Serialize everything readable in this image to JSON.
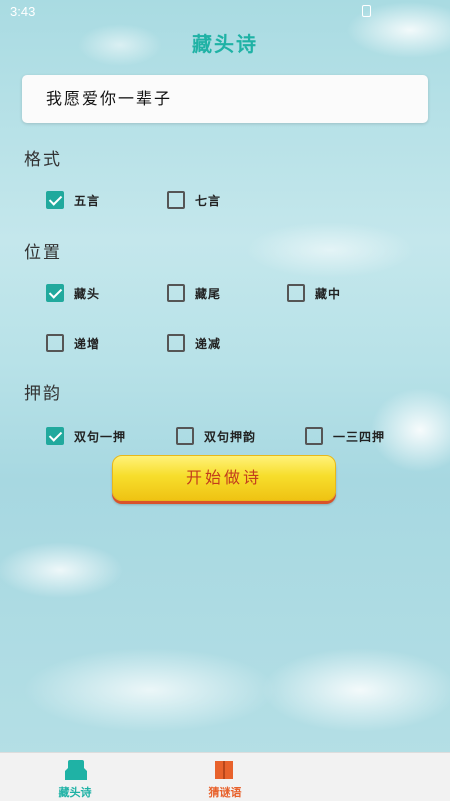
{
  "status_bar": {
    "time": "3:43"
  },
  "header": {
    "title": "藏头诗"
  },
  "input": {
    "value": "我愿爱你一辈子"
  },
  "format": {
    "label": "格式",
    "options": [
      {
        "label": "五言",
        "checked": true
      },
      {
        "label": "七言",
        "checked": false
      }
    ]
  },
  "position": {
    "label": "位置",
    "options": [
      {
        "label": "藏头",
        "checked": true
      },
      {
        "label": "藏尾",
        "checked": false
      },
      {
        "label": "藏中",
        "checked": false
      },
      {
        "label": "递增",
        "checked": false
      },
      {
        "label": "递减",
        "checked": false
      }
    ]
  },
  "rhyme": {
    "label": "押韵",
    "options": [
      {
        "label": "双句一押",
        "checked": true
      },
      {
        "label": "双句押韵",
        "checked": false
      },
      {
        "label": "一三四押",
        "checked": false
      }
    ]
  },
  "action": {
    "label": "开始做诗"
  },
  "tabs": [
    {
      "label": "藏头诗",
      "active": true,
      "icon": "home-icon",
      "color": "#1fb2a5"
    },
    {
      "label": "猜谜语",
      "active": false,
      "icon": "book-icon",
      "color": "#e8622c"
    }
  ],
  "colors": {
    "accent": "#21a99d",
    "button": "#f7de2c",
    "button_text": "#c23d1d"
  }
}
